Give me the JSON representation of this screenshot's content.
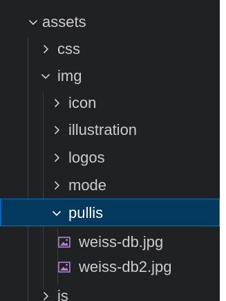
{
  "explorer": {
    "items": [
      {
        "label": "assets",
        "kind": "folder",
        "state": "expanded"
      },
      {
        "label": "css",
        "kind": "folder",
        "state": "collapsed"
      },
      {
        "label": "img",
        "kind": "folder",
        "state": "expanded"
      },
      {
        "label": "icon",
        "kind": "folder",
        "state": "collapsed"
      },
      {
        "label": "illustration",
        "kind": "folder",
        "state": "collapsed"
      },
      {
        "label": "logos",
        "kind": "folder",
        "state": "collapsed"
      },
      {
        "label": "mode",
        "kind": "folder",
        "state": "collapsed"
      },
      {
        "label": "pullis",
        "kind": "folder",
        "state": "expanded",
        "selected": true
      },
      {
        "label": "weiss-db.jpg",
        "kind": "file",
        "icon": "image-file-icon"
      },
      {
        "label": "weiss-db2.jpg",
        "kind": "file",
        "icon": "image-file-icon"
      },
      {
        "label": "is",
        "kind": "folder",
        "state": "collapsed"
      }
    ]
  },
  "colors": {
    "background": "#1f2122",
    "text": "#cccccc",
    "selected_background": "#04395e",
    "selected_border": "#0078d4",
    "image_icon": "#b180d7"
  }
}
